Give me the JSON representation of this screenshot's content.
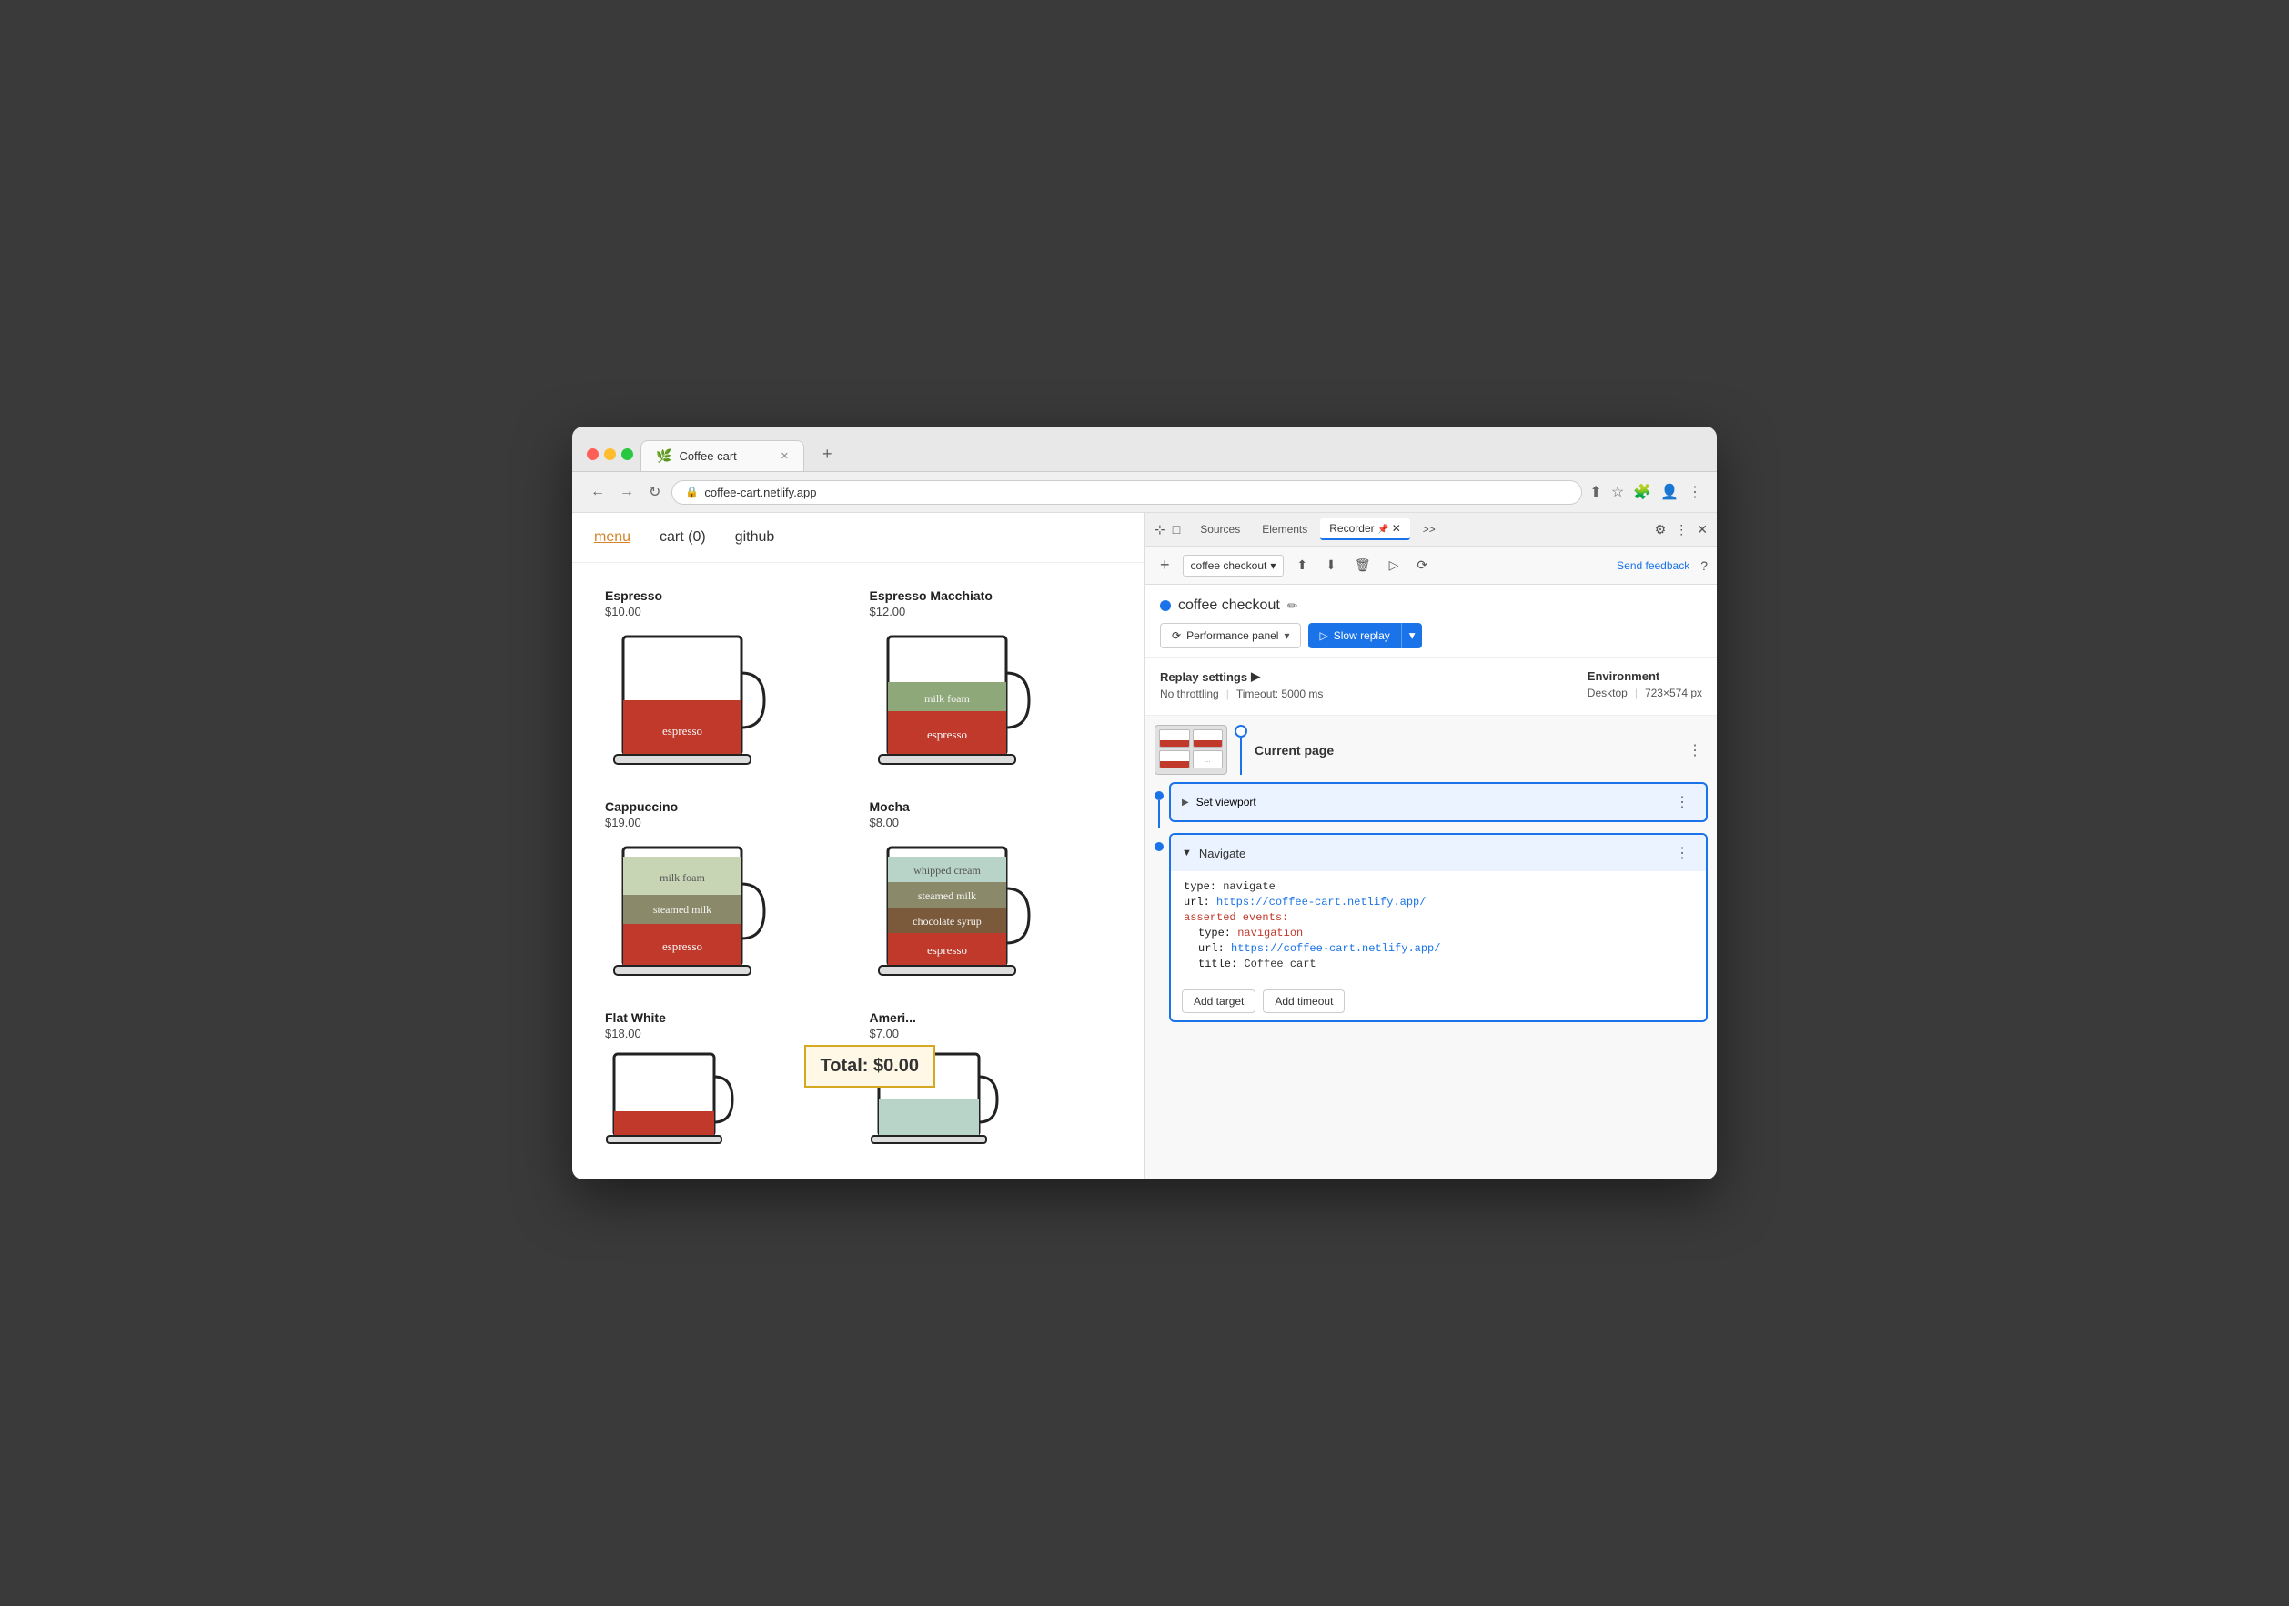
{
  "browser": {
    "url": "coffee-cart.netlify.app",
    "tab_title": "Coffee cart",
    "tab_favicon": "☕"
  },
  "coffee_nav": {
    "items": [
      "menu",
      "cart (0)",
      "github"
    ],
    "active": "menu"
  },
  "coffee_items": [
    {
      "name": "Espresso",
      "price": "$10.00",
      "layers": [
        {
          "label": "espresso",
          "color": "#c0392b",
          "height": 45
        }
      ],
      "cup_bg": "#fff"
    },
    {
      "name": "Espresso Macchiato",
      "price": "$12.00",
      "layers": [
        {
          "label": "milk foam",
          "color": "#8fa87a",
          "height": 25
        },
        {
          "label": "espresso",
          "color": "#c0392b",
          "height": 45
        }
      ],
      "cup_bg": "#fff"
    },
    {
      "name": "Cappuccino",
      "price": "$19.00",
      "layers": [
        {
          "label": "milk foam",
          "color": "#c8d5b5",
          "height": 45
        },
        {
          "label": "steamed milk",
          "color": "#8a8a6a",
          "height": 30
        },
        {
          "label": "espresso",
          "color": "#c0392b",
          "height": 35
        }
      ],
      "cup_bg": "#fff"
    },
    {
      "name": "Mocha",
      "price": "$8.00",
      "layers": [
        {
          "label": "whipped cream",
          "color": "#b8d4c8",
          "height": 30
        },
        {
          "label": "steamed milk",
          "color": "#8a8a6a",
          "height": 30
        },
        {
          "label": "chocolate syrup",
          "color": "#7a5a3a",
          "height": 28
        },
        {
          "label": "espresso",
          "color": "#c0392b",
          "height": 28
        }
      ],
      "cup_bg": "#fff"
    },
    {
      "name": "Flat White",
      "price": "$18.00"
    },
    {
      "name": "Ameri...",
      "price": "$7.00"
    }
  ],
  "total": "Total: $0.00",
  "devtools": {
    "tabs": [
      "Sources",
      "Elements",
      "Recorder",
      ">>"
    ],
    "active_tab": "Recorder",
    "recording_name": "coffee checkout",
    "btn_performance_panel": "Performance panel",
    "btn_slow_replay": "Slow replay",
    "send_feedback": "Send feedback"
  },
  "replay_settings": {
    "label": "Replay settings",
    "throttling": "No throttling",
    "timeout": "Timeout: 5000 ms",
    "env_label": "Environment",
    "env_value": "Desktop",
    "resolution": "723×574 px"
  },
  "current_page": {
    "label": "Current page"
  },
  "steps": [
    {
      "name": "Set viewport",
      "collapsed": true
    },
    {
      "name": "Navigate",
      "collapsed": false,
      "code": [
        {
          "key": "type:",
          "val": "navigate",
          "key_class": "",
          "val_class": ""
        },
        {
          "key": "url:",
          "val": "https://coffee-cart.netlify.app/",
          "key_class": "",
          "val_class": "link"
        },
        {
          "key": "asserted events:",
          "val": "",
          "key_class": "orange",
          "val_class": ""
        },
        {
          "key": "  type:",
          "val": "navigation",
          "key_class": "",
          "val_class": "orange",
          "indent": true
        },
        {
          "key": "  url:",
          "val": "https://coffee-cart.netlify.app/",
          "key_class": "",
          "val_class": "link",
          "indent": true
        },
        {
          "key": "  title:",
          "val": "Coffee cart",
          "key_class": "",
          "val_class": "",
          "indent": true
        }
      ],
      "buttons": [
        "Add target",
        "Add timeout"
      ]
    }
  ]
}
